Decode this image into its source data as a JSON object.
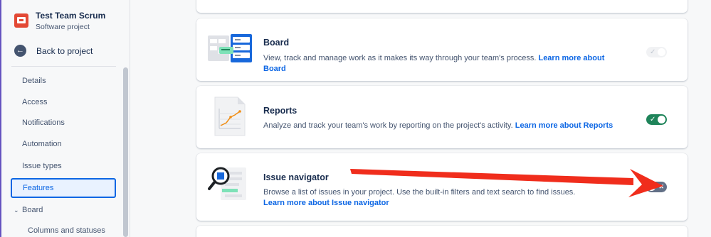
{
  "project": {
    "name": "Test Team Scrum",
    "type": "Software project"
  },
  "sidebar": {
    "back_label": "Back to project",
    "items": [
      {
        "label": "Details"
      },
      {
        "label": "Access"
      },
      {
        "label": "Notifications"
      },
      {
        "label": "Automation"
      },
      {
        "label": "Issue types"
      },
      {
        "label": "Features",
        "active": true
      }
    ],
    "group": {
      "label": "Board",
      "expanded": true
    },
    "sub_items": [
      {
        "label": "Columns and statuses"
      }
    ]
  },
  "features": [
    {
      "title": "Board",
      "description": "View, track and manage work as it makes its way through your team's process.",
      "link": "Learn more about Board",
      "toggle": "disabled-on"
    },
    {
      "title": "Reports",
      "description": "Analyze and track your team's work by reporting on the project's activity.",
      "link": "Learn more about Reports",
      "toggle": "on"
    },
    {
      "title": "Issue navigator",
      "description": "Browse a list of issues in your project. Use the built-in filters and text search to find issues.",
      "link": "Learn more about Issue navigator",
      "toggle": "off"
    }
  ],
  "icons": {
    "back": "arrow-left-icon",
    "chevron": "chevron-down-icon",
    "toggle_on": "check-icon",
    "toggle_off": "cross-icon"
  },
  "colors": {
    "accent": "#0c66e4",
    "toggle_on": "#1f845a",
    "toggle_off": "#626f86",
    "annotation_arrow": "#f02d1c",
    "project_avatar": "#e34935"
  }
}
